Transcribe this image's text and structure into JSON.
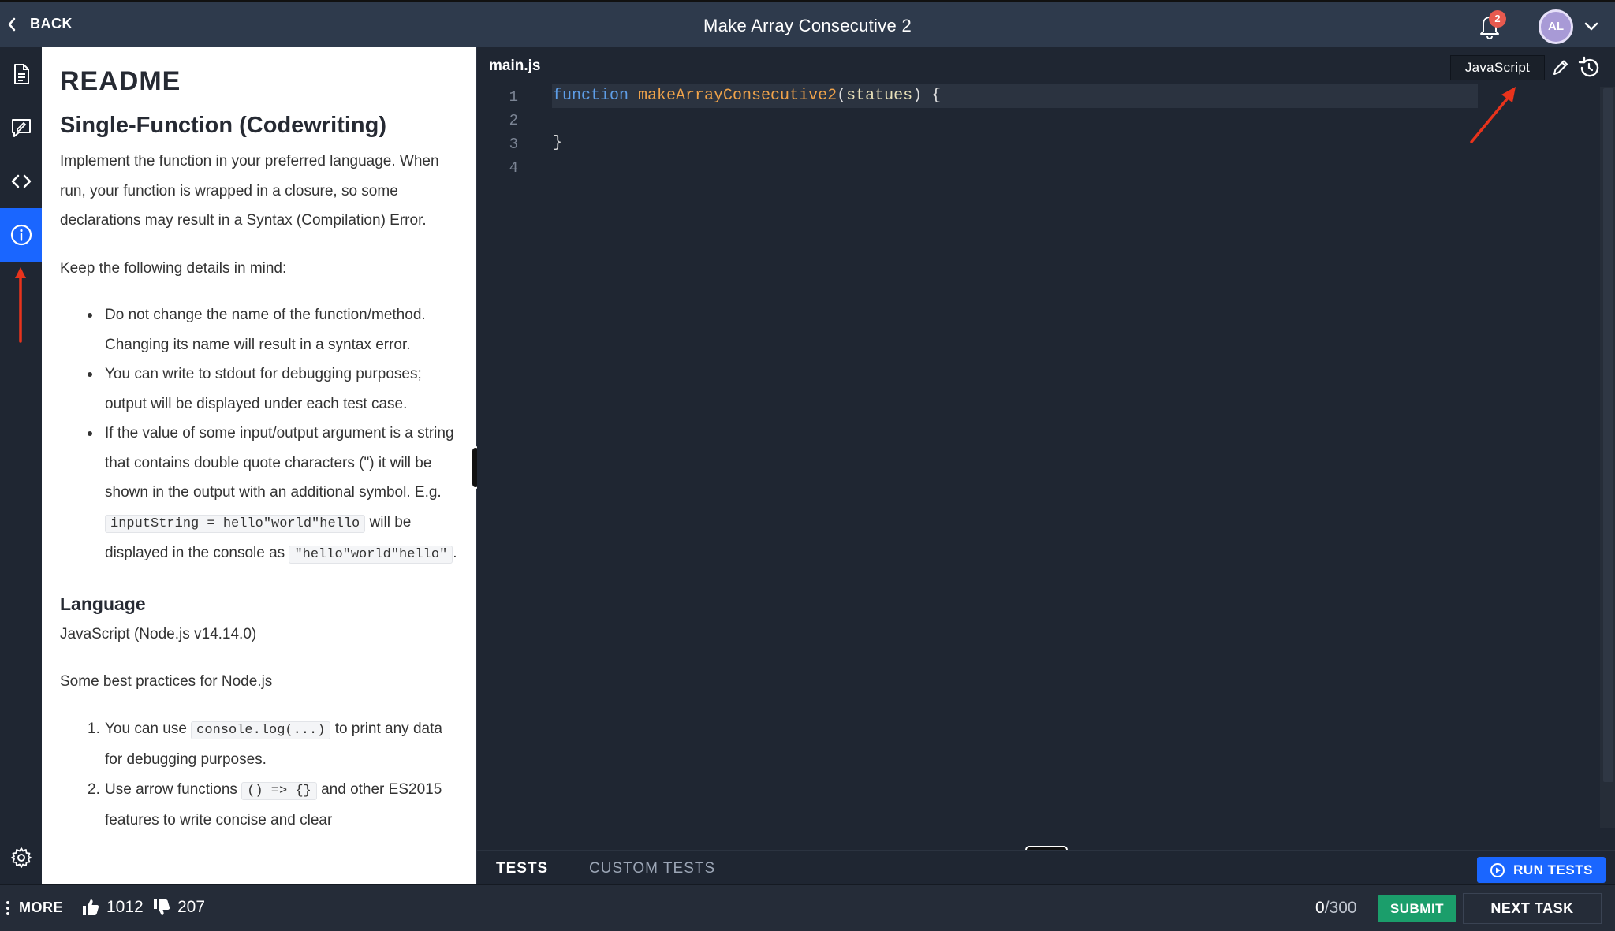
{
  "header": {
    "back_label": "BACK",
    "title": "Make Array Consecutive 2",
    "notification_count": "2",
    "avatar_initials": "AL"
  },
  "rail": {
    "icons": [
      "description-icon",
      "solutions-icon",
      "code-icon",
      "info-icon",
      "settings-icon"
    ],
    "active": "info-icon"
  },
  "readme": {
    "heading": "README",
    "subheading": "Single-Function (Codewriting)",
    "intro": "Implement the function in your preferred language. When run, your function is wrapped in a closure, so some declarations may result in a Syntax (Compilation) Error.",
    "details_intro": "Keep the following details in mind:",
    "bullets": [
      "Do not change the name of the function/method. Changing its name will result in a syntax error.",
      "You can write to stdout for debugging purposes; output will be displayed under each test case."
    ],
    "bullet3": {
      "text_a": "If the value of some input/output argument is a string that contains double quote characters (\") it will be shown in the output with an additional symbol. E.g.",
      "code_a": "inputString = hello\"world\"hello",
      "text_b": "will be displayed in the console as",
      "code_b": "\"hello\"world\"hello\"",
      "text_c": "."
    },
    "language_heading": "Language",
    "language_value": "JavaScript (Node.js v14.14.0)",
    "best_practices": "Some best practices for Node.js",
    "numbered": [
      {
        "num": "1.",
        "text_a": "You can use",
        "code": "console.log(...)",
        "text_b": "to print any data for debugging purposes."
      },
      {
        "num": "2.",
        "text_a": "Use arrow functions",
        "code": "() => {}",
        "text_b": "and other ES2015 features to write concise and clear"
      }
    ]
  },
  "editor": {
    "filename": "main.js",
    "language": "JavaScript",
    "line_numbers": [
      "1",
      "2",
      "3",
      "4"
    ],
    "code": {
      "keyword": "function",
      "name": "makeArrayConsecutive2",
      "open_paren": "(",
      "param": "statues",
      "close": ") {",
      "closing_brace": "}"
    }
  },
  "tests": {
    "tabs": [
      "TESTS",
      "CUSTOM TESTS"
    ],
    "active_tab": "TESTS",
    "run_label": "RUN TESTS"
  },
  "footer": {
    "more_label": "MORE",
    "upvotes": "1012",
    "downvotes": "207",
    "score": "0",
    "score_total": "/300",
    "submit_label": "SUBMIT",
    "next_label": "NEXT TASK"
  },
  "colors": {
    "accent_blue": "#1a66ff",
    "submit_green": "#1b9e6b",
    "annotation_red": "#e8331c",
    "topbar": "#2e3a4c",
    "editor_bg": "#1f2632"
  }
}
